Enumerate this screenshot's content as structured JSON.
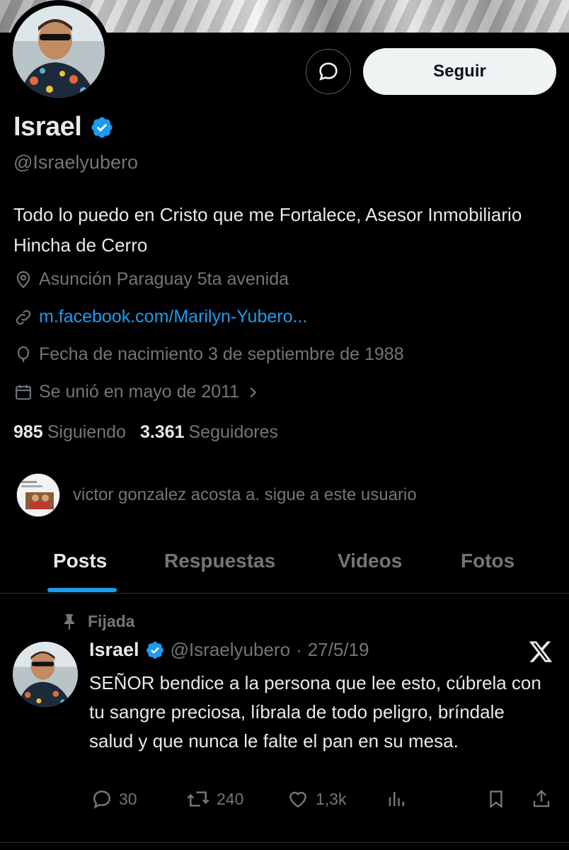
{
  "profile": {
    "name": "Israel",
    "handle": "@Israelyubero",
    "bio": "Todo lo puedo en Cristo que me Fortalece, Asesor Inmobiliario Hincha de Cerro",
    "location": "Asunción Paraguay 5ta avenida",
    "website": "m.facebook.com/Marilyn-Yubero...",
    "birthday": "Fecha de nacimiento 3 de septiembre de 1988",
    "joined": "Se unió en mayo de 2011",
    "following_count": "985",
    "following_label": "Siguiendo",
    "followers_count": "3.361",
    "followers_label": "Seguidores",
    "followed_by": "victor gonzalez acosta a. sigue a este usuario"
  },
  "actions": {
    "follow_label": "Seguir"
  },
  "tabs": [
    {
      "label": "Posts",
      "active": true
    },
    {
      "label": "Respuestas",
      "active": false
    },
    {
      "label": "Videos",
      "active": false
    },
    {
      "label": "Fotos",
      "active": false
    }
  ],
  "pinned_post": {
    "pinned_label": "Fijada",
    "author_name": "Israel",
    "author_handle": "@Israelyubero",
    "separator": "·",
    "date": "27/5/19",
    "text": "SEÑOR bendice a la persona que lee esto, cúbrela con tu sangre preciosa, líbrala de todo peligro, bríndale salud y que nunca le falte el pan en su mesa.",
    "replies": "30",
    "reposts": "240",
    "likes": "1,3k"
  },
  "colors": {
    "background": "#000000",
    "text_primary": "#e7e9ea",
    "text_secondary": "#71767b",
    "accent": "#1d9bf0",
    "verified": "#1d9bf0"
  },
  "icons": [
    "message-icon",
    "verified-badge-icon",
    "location-icon",
    "link-icon",
    "balloon-icon",
    "calendar-icon",
    "chevron-right-icon",
    "pin-icon",
    "x-logo-icon",
    "reply-icon",
    "repost-icon",
    "like-icon",
    "views-icon",
    "bookmark-icon",
    "share-icon"
  ]
}
